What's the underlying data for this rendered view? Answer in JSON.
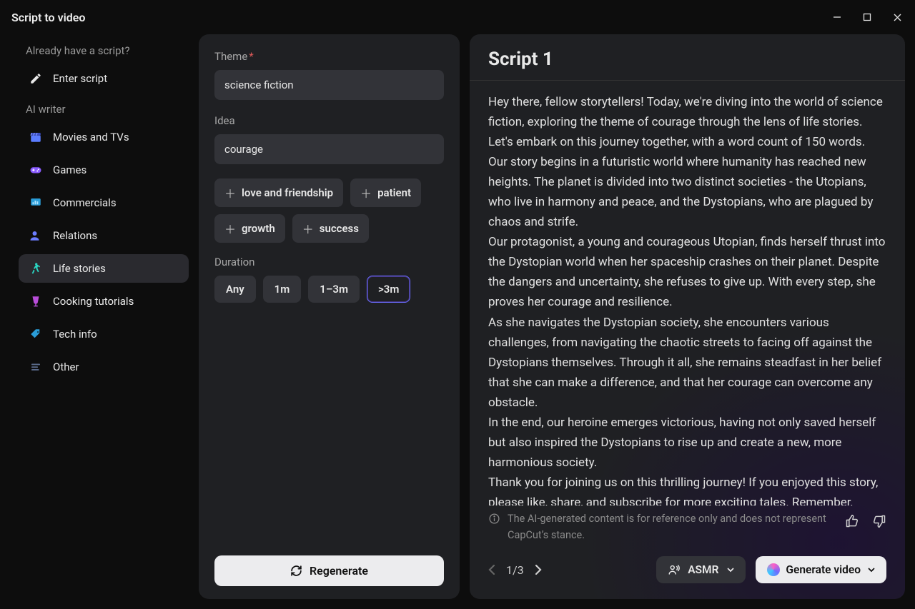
{
  "window": {
    "title": "Script to video"
  },
  "sidebar": {
    "prompt": "Already have a script?",
    "enter_script": "Enter script",
    "ai_writer_label": "AI writer",
    "items": [
      {
        "label": "Movies and TVs"
      },
      {
        "label": "Games"
      },
      {
        "label": "Commercials"
      },
      {
        "label": "Relations"
      },
      {
        "label": "Life stories"
      },
      {
        "label": "Cooking tutorials"
      },
      {
        "label": "Tech info"
      },
      {
        "label": "Other"
      }
    ]
  },
  "form": {
    "theme_label": "Theme",
    "theme_value": "science fiction",
    "idea_label": "Idea",
    "idea_value": "courage",
    "suggestions": [
      "love and friendship",
      "patient",
      "growth",
      "success"
    ],
    "duration_label": "Duration",
    "durations": [
      "Any",
      "1m",
      "1–3m",
      ">3m"
    ],
    "duration_selected": ">3m",
    "regenerate": "Regenerate"
  },
  "script": {
    "title": "Script 1",
    "paragraphs": [
      "Hey there, fellow storytellers! Today, we're diving into the world of science fiction, exploring the theme of courage through the lens of life stories. Let's embark on this journey together, with a word count of 150 words.",
      "Our story begins in a futuristic world where humanity has reached new heights. The planet is divided into two distinct societies - the Utopians, who live in harmony and peace, and the Dystopians, who are plagued by chaos and strife.",
      "Our protagonist, a young and courageous Utopian, finds herself thrust into the Dystopian world when her spaceship crashes on their planet. Despite the dangers and uncertainty, she refuses to give up. With every step, she proves her courage and resilience.",
      "As she navigates the Dystopian society, she encounters various challenges, from navigating the chaotic streets to facing off against the Dystopians themselves. Through it all, she remains steadfast in her belief that she can make a difference, and that her courage can overcome any obstacle.",
      "In the end, our heroine emerges victorious, having not only saved herself but also inspired the Dystopians to rise up and create a new, more harmonious society.",
      "Thank you for joining us on this thrilling journey! If you enjoyed this story, please like, share, and subscribe for more exciting tales. Remember, courage is not the absence of fear, but the triumph"
    ],
    "disclaimer": "The AI-generated content is for reference only and does not represent CapCut’s stance.",
    "page_current": 1,
    "page_total": 3,
    "page_display": "1/3",
    "voice": "ASMR",
    "generate": "Generate video"
  }
}
